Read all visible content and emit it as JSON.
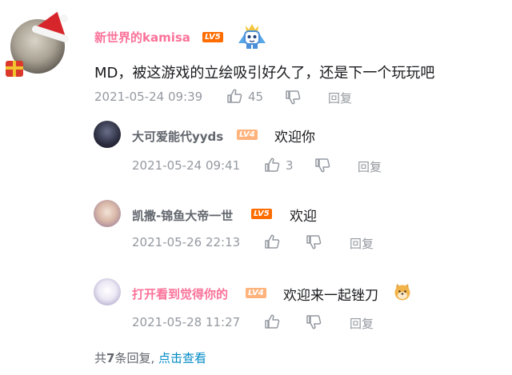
{
  "comment": {
    "username": "新世界的kamisa",
    "level": "LV5",
    "text": "MD，被这游戏的立绘吸引好久了，还是下一个玩玩吧",
    "date": "2021-05-24 09:39",
    "likes": "45",
    "reply_label": "回复"
  },
  "replies": [
    {
      "username": "大可爱能代yyds",
      "level": "LV4",
      "text": "欢迎你",
      "date": "2021-05-24 09:41",
      "likes": "3",
      "reply_label": "回复"
    },
    {
      "username": "凯撒-锦鱼大帝一世",
      "level": "LV5",
      "text": "欢迎",
      "date": "2021-05-26 22:13",
      "likes": "",
      "reply_label": "回复"
    },
    {
      "username": "打开看到觉得你的",
      "level": "LV4",
      "text": "欢迎来一起锉刀",
      "date": "2021-05-28 11:27",
      "likes": "",
      "reply_label": "回复"
    }
  ],
  "footer": {
    "prefix": "共",
    "count": "7",
    "suffix": "条回复,",
    "link": "点击查看"
  },
  "colors": {
    "pink_name": "#fb7299",
    "meta": "#9499a0",
    "link": "#008ac5",
    "lv5": "#ff6c00",
    "lv4": "#ffb37c"
  }
}
